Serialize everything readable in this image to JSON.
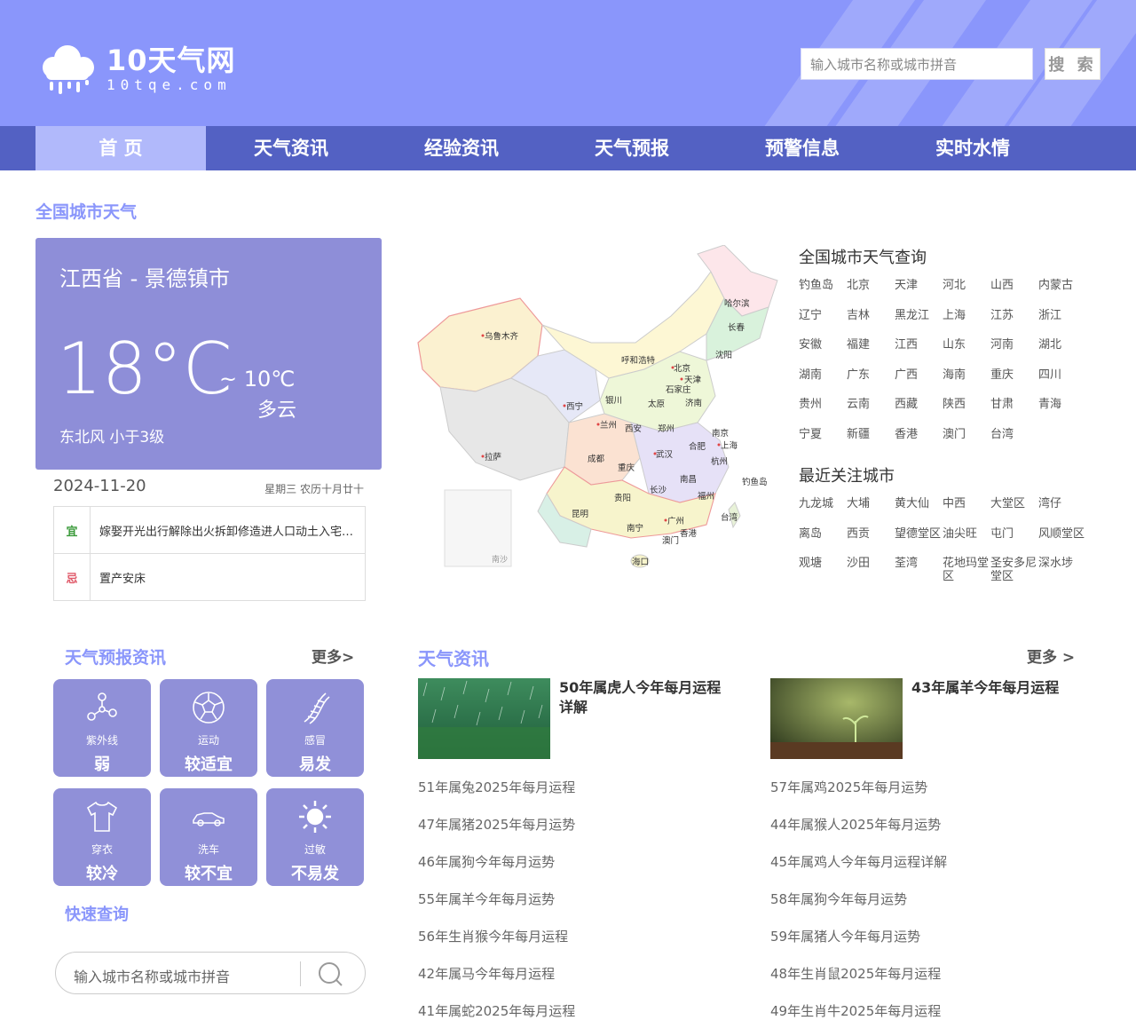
{
  "header": {
    "logo_title": "10天气网",
    "logo_sub": "10tqe.com",
    "search_placeholder": "输入城市名称或城市拼音",
    "search_button": "搜 索"
  },
  "nav": {
    "items": [
      {
        "label": "首 页",
        "active": true
      },
      {
        "label": "天气资讯",
        "active": false
      },
      {
        "label": "经验资讯",
        "active": false
      },
      {
        "label": "天气预报",
        "active": false
      },
      {
        "label": "预警信息",
        "active": false
      },
      {
        "label": "实时水情",
        "active": false
      }
    ]
  },
  "national_title": "全国城市天气",
  "weather": {
    "city": "江西省 - 景德镇市",
    "temp": "18°C",
    "low": "~ 10℃",
    "desc": "多云",
    "wind": "东北风  小于3级",
    "date": "2024-11-20",
    "lunar": "星期三  农历十月廿十"
  },
  "almanac": {
    "yi_tag": "宜",
    "yi_text": "嫁娶开光出行解除出火拆卸修造进人口动土入宅移徙安床栽种纳畜入殓安葬",
    "ji_tag": "忌",
    "ji_text": "置产安床"
  },
  "map": {
    "south_sea_label": "南沙",
    "cities": [
      "乌鲁木齐",
      "拉萨",
      "西宁",
      "兰州",
      "银川",
      "呼和浩特",
      "西安",
      "成都",
      "重庆",
      "贵阳",
      "昆明",
      "南宁",
      "海口",
      "长沙",
      "武汉",
      "郑州",
      "太原",
      "石家庄",
      "北京",
      "天津",
      "济南",
      "合肥",
      "南京",
      "上海",
      "杭州",
      "南昌",
      "福州",
      "台湾",
      "广州",
      "香港",
      "澳门",
      "沈阳",
      "长春",
      "哈尔滨",
      "钓鱼岛"
    ]
  },
  "city_query": {
    "title": "全国城市天气查询",
    "cities": [
      "钓鱼岛",
      "北京",
      "天津",
      "河北",
      "山西",
      "内蒙古",
      "辽宁",
      "吉林",
      "黑龙江",
      "上海",
      "江苏",
      "浙江",
      "安徽",
      "福建",
      "江西",
      "山东",
      "河南",
      "湖北",
      "湖南",
      "广东",
      "广西",
      "海南",
      "重庆",
      "四川",
      "贵州",
      "云南",
      "西藏",
      "陕西",
      "甘肃",
      "青海",
      "宁夏",
      "新疆",
      "香港",
      "澳门",
      "台湾"
    ]
  },
  "recent": {
    "title": "最近关注城市",
    "cities": [
      "九龙城",
      "大埔",
      "黄大仙",
      "中西",
      "大堂区",
      "湾仔",
      "离岛",
      "西贡",
      "望德堂区",
      "油尖旺",
      "屯门",
      "风顺堂区",
      "观塘",
      "沙田",
      "荃湾",
      "花地玛堂区",
      "圣安多尼堂区",
      "深水埗"
    ]
  },
  "forecast": {
    "title": "天气预报资讯",
    "more": "更多>",
    "tiles": [
      {
        "label": "紫外线",
        "value": "弱",
        "icon": "molecule-icon"
      },
      {
        "label": "运动",
        "value": "较适宜",
        "icon": "soccer-ball-icon"
      },
      {
        "label": "感冒",
        "value": "易发",
        "icon": "dna-icon"
      },
      {
        "label": "穿衣",
        "value": "较冷",
        "icon": "tshirt-icon"
      },
      {
        "label": "洗车",
        "value": "较不宜",
        "icon": "car-icon"
      },
      {
        "label": "过敏",
        "value": "不易发",
        "icon": "sun-icon"
      }
    ]
  },
  "quick": {
    "title": "快速查询",
    "placeholder": "输入城市名称或城市拼音"
  },
  "news": {
    "title": "天气资讯",
    "more": "更多 >",
    "featured": [
      {
        "title": "50年属虎人今年每月运程详解"
      },
      {
        "title": "43年属羊今年每月运程"
      }
    ],
    "left": [
      "51年属兔2025年每月运程",
      "47年属猪2025年每月运势",
      "46年属狗今年每月运势",
      "55年属羊今年每月运势",
      "56年生肖猴今年每月运程",
      "42年属马今年每月运程",
      "41年属蛇2025年每月运程"
    ],
    "right": [
      "57年属鸡2025年每月运势",
      "44年属猴人2025年每月运势",
      "45年属鸡人今年每月运程详解",
      "58年属狗今年每月运势",
      "59年属猪人今年每月运势",
      "48年生肖鼠2025年每月运程",
      "49年生肖牛2025年每月运程"
    ]
  }
}
